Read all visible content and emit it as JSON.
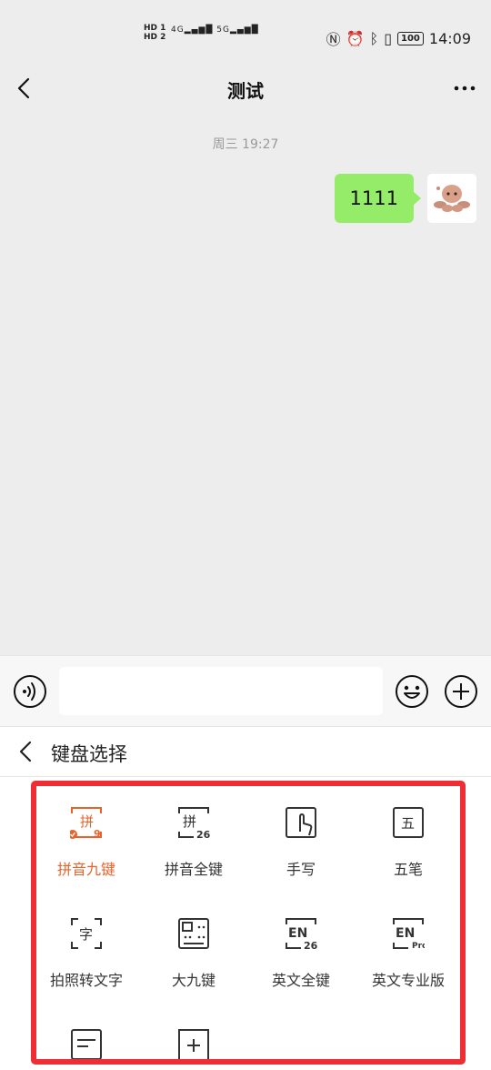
{
  "status_bar": {
    "sim1": "HD 1",
    "sim2": "HD 2",
    "signal1": "4G",
    "signal2": "5G",
    "battery": "100",
    "time": "14:09"
  },
  "header": {
    "title": "测试"
  },
  "chat": {
    "timestamp": "周三 19:27",
    "messages": [
      {
        "text": "1111",
        "from": "me"
      }
    ]
  },
  "panel": {
    "title": "键盘选择",
    "items": [
      {
        "label": "拼音九键",
        "icon_char": "拼",
        "icon_sub": "9",
        "selected": true
      },
      {
        "label": "拼音全键",
        "icon_char": "拼",
        "icon_sub": "26",
        "selected": false
      },
      {
        "label": "手写",
        "icon_char": "",
        "icon_sub": "",
        "selected": false
      },
      {
        "label": "五笔",
        "icon_char": "五",
        "icon_sub": "",
        "selected": false
      },
      {
        "label": "拍照转文字",
        "icon_char": "字",
        "icon_sub": "",
        "selected": false
      },
      {
        "label": "大九键",
        "icon_char": "",
        "icon_sub": "",
        "selected": false
      },
      {
        "label": "英文全键",
        "icon_char": "EN",
        "icon_sub": "26",
        "selected": false
      },
      {
        "label": "英文专业版",
        "icon_char": "EN",
        "icon_sub": "Pro",
        "selected": false
      },
      {
        "label": "",
        "icon_char": "",
        "icon_sub": "",
        "selected": false
      },
      {
        "label": "",
        "icon_char": "+",
        "icon_sub": "",
        "selected": false
      }
    ]
  },
  "colors": {
    "accent": "#e8632b",
    "bubble": "#95ec69",
    "highlight_box": "#ee2d34"
  }
}
